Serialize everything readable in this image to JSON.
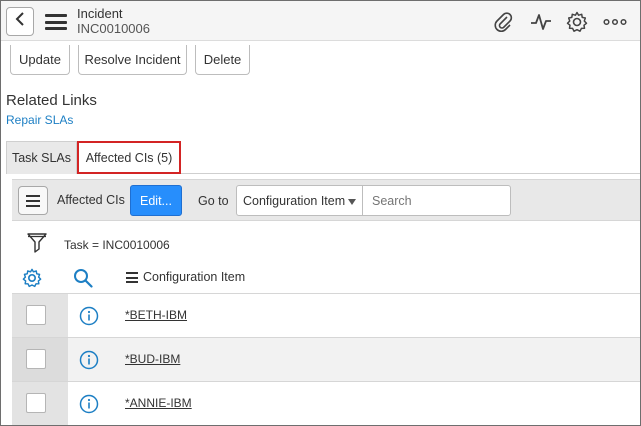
{
  "header": {
    "title": "Incident",
    "number": "INC0010006",
    "icons": [
      "back-icon",
      "hamburger-menu-icon",
      "paperclip-icon",
      "activity-icon",
      "gear-icon",
      "more-icon"
    ]
  },
  "actions": {
    "update": "Update",
    "resolve": "Resolve Incident",
    "delete": "Delete"
  },
  "related_links": {
    "title": "Related Links",
    "repair": "Repair SLAs"
  },
  "tabs": [
    {
      "label": "Task SLAs",
      "selected": false
    },
    {
      "label": "Affected CIs (5)",
      "selected": true
    }
  ],
  "list": {
    "title": "Affected CIs",
    "edit_label": "Edit...",
    "goto_label": "Go to",
    "goto_field": "Configuration Item",
    "search_placeholder": "Search",
    "filter": "Task = INC0010006",
    "column": "Configuration Item",
    "rows": [
      {
        "ci": "*BETH-IBM"
      },
      {
        "ci": "*BUD-IBM"
      },
      {
        "ci": "*ANNIE-IBM"
      }
    ]
  },
  "colors": {
    "accent": "#278efc",
    "link": "#1d7fc4",
    "highlight": "#d32424"
  }
}
